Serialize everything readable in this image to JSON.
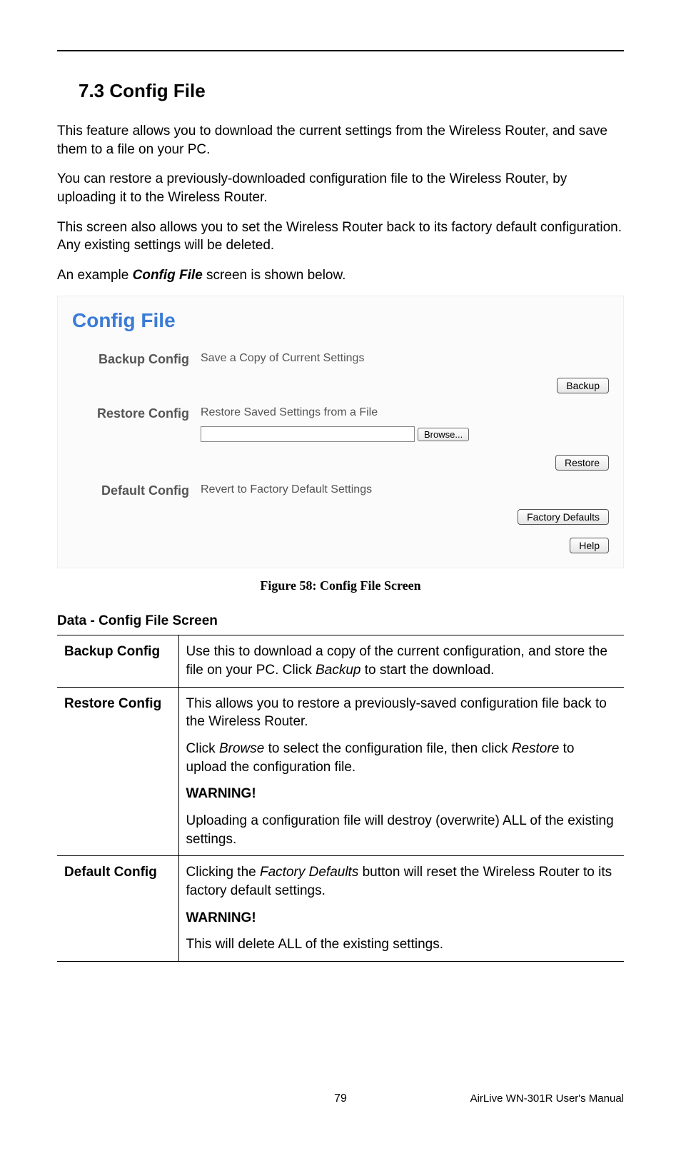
{
  "section": {
    "number": "7.3",
    "title": "Config File",
    "heading": "7.3  Config File"
  },
  "paragraphs": {
    "p1": "This feature allows you to download the current settings from the Wireless Router, and save them to a file on your PC.",
    "p2": "You can restore a previously-downloaded configuration file to the Wireless Router, by uploading it to the Wireless Router.",
    "p3": "This screen also allows you to set the Wireless Router back to its factory default configuration. Any existing settings will be deleted.",
    "p4_prefix": "An example ",
    "p4_bold": "Config File",
    "p4_suffix": " screen is shown below."
  },
  "config_screen": {
    "title": "Config File",
    "backup": {
      "label": "Backup Config",
      "desc": "Save a Copy of Current Settings",
      "button": "Backup"
    },
    "restore": {
      "label": "Restore Config",
      "desc": "Restore Saved Settings from a File",
      "browse_button": "Browse...",
      "button": "Restore"
    },
    "default": {
      "label": "Default Config",
      "desc": "Revert to Factory Default Settings",
      "button": "Factory Defaults"
    },
    "help_button": "Help"
  },
  "figure_caption": "Figure 58: Config File Screen",
  "table": {
    "heading": "Data - Config File Screen",
    "rows": {
      "backup": {
        "label": "Backup Config",
        "p1a": "Use this to download a copy of the current configuration, and store the file on your PC. Click ",
        "p1b": "Backup",
        "p1c": " to start the download."
      },
      "restore": {
        "label": "Restore Config",
        "p1": "This allows you to restore a previously-saved configuration file back to the Wireless Router.",
        "p2a": "Click ",
        "p2b": "Browse",
        "p2c": " to select the configuration file, then click ",
        "p2d": "Restore",
        "p2e": " to upload the configuration file.",
        "warn": "WARNING!",
        "p3": "Uploading a configuration file will destroy (overwrite) ALL of the existing settings."
      },
      "default": {
        "label": "Default Config",
        "p1a": "Clicking the ",
        "p1b": "Factory Defaults",
        "p1c": " button will reset the Wireless Router to its factory default settings.",
        "warn": "WARNING!",
        "p2": "This will delete ALL of the existing settings."
      }
    }
  },
  "footer": {
    "page": "79",
    "manual": "AirLive WN-301R User's Manual"
  }
}
